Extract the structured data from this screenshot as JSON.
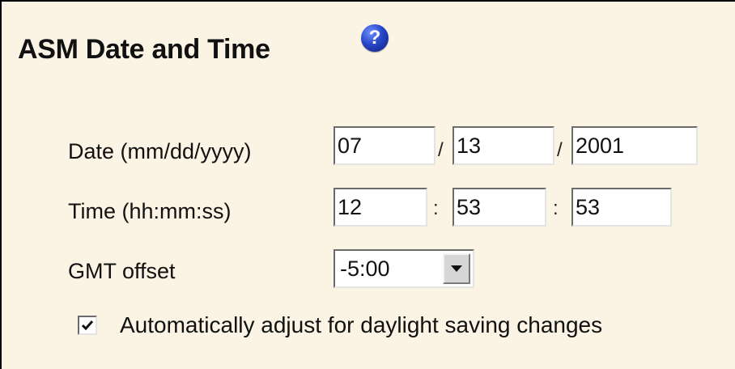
{
  "header": {
    "title": "ASM Date and Time",
    "help_icon": "help-question-icon",
    "help_glyph": "?"
  },
  "date": {
    "label": "Date (mm/dd/yyyy)",
    "month": "07",
    "day": "13",
    "year": "2001",
    "separator": "/"
  },
  "time": {
    "label": "Time (hh:mm:ss)",
    "hours": "12",
    "minutes": "53",
    "seconds": "53",
    "separator": ":"
  },
  "gmt": {
    "label": "GMT offset",
    "selected": "-5:00"
  },
  "dst": {
    "checked": true,
    "label": "Automatically adjust for daylight saving changes"
  },
  "colors": {
    "background": "#fbf3e3",
    "help_icon": "#2847c8"
  }
}
